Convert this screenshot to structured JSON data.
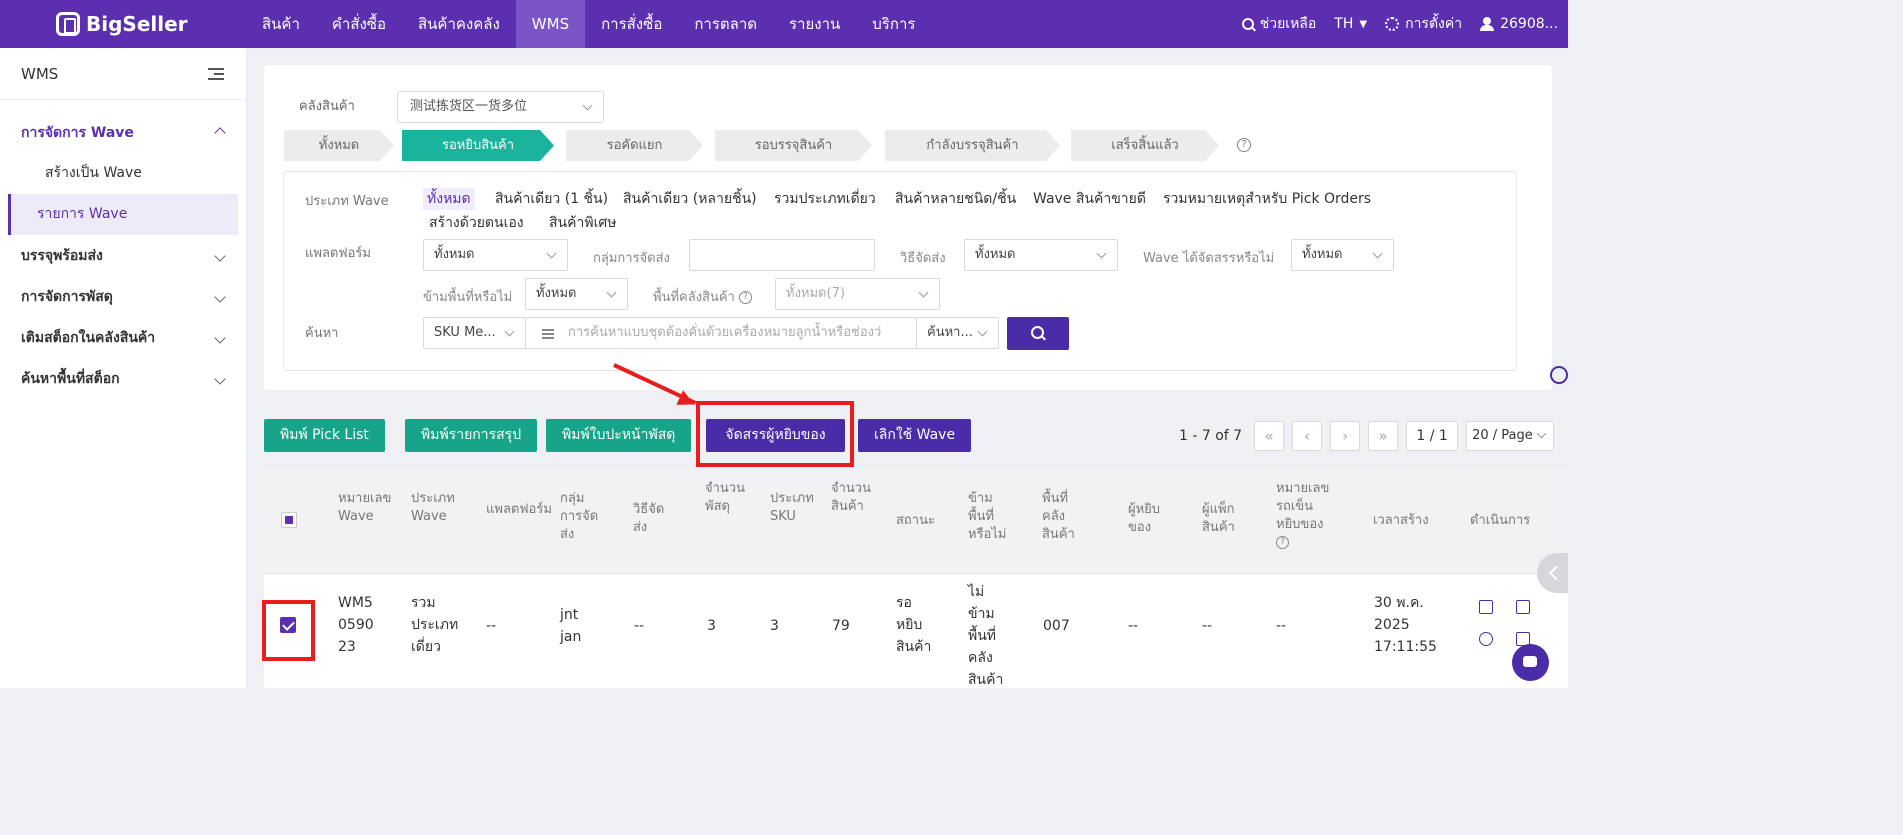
{
  "app": {
    "brand": "BigSeller"
  },
  "nav": {
    "items": [
      "สินค้า",
      "คำสั่งซื้อ",
      "สินค้าคงคลัง",
      "WMS",
      "การสั่งซื้อ",
      "การตลาด",
      "รายงาน",
      "บริการ"
    ],
    "active": "WMS",
    "help": "ช่วยเหลือ",
    "lang": "TH",
    "settings": "การตั้งค่า",
    "user": "26908..."
  },
  "sidebar": {
    "title": "WMS",
    "groups": [
      {
        "label": "การจัดการ Wave",
        "open": true,
        "children": [
          "สร้างเป็น Wave",
          "รายการ Wave"
        ]
      },
      {
        "label": "บรรจุพร้อมส่ง"
      },
      {
        "label": "การจัดการพัสดุ"
      },
      {
        "label": "เติมสต็อกในคลังสินค้า"
      },
      {
        "label": "ค้นหาพื้นที่สต็อก"
      }
    ],
    "active_child": "รายการ Wave"
  },
  "filter": {
    "warehouse_label": "คลังสินค้า",
    "warehouse_value": "测试拣货区一货多位",
    "steps": [
      "ทั้งหมด",
      "รอหยิบสินค้า",
      "รอคัดแยก",
      "รอบรรจุสินค้า",
      "กำลังบรรจุสินค้า",
      "เสร็จสิ้นแล้ว"
    ],
    "active_step": "รอหยิบสินค้า",
    "help_mark": "?",
    "wave_type_label": "ประเภท Wave",
    "wave_types": [
      "ทั้งหมด",
      "สินค้าเดียว (1 ชิ้น)",
      "สินค้าเดียว (หลายชิ้น)",
      "รวมประเภทเดี่ยว",
      "สินค้าหลายชนิด/ชิ้น",
      "Wave สินค้าขายดี",
      "รวมหมายเหตุสำหรับ Pick Orders",
      "สร้างด้วยตนเอง",
      "สินค้าพิเศษ"
    ],
    "platform_label": "แพลตฟอร์ม",
    "platform_value": "ทั้งหมด",
    "ship_group_label": "กลุ่มการจัดส่ง",
    "ship_group_value": "",
    "ship_method_label": "วิธีจัดส่ง",
    "ship_method_value": "ทั้งหมด",
    "assigned_label": "Wave ได้จัดสรรหรือไม่",
    "assigned_value": "ทั้งหมด",
    "cross_area_label": "ข้ามพื้นที่หรือไม่",
    "cross_area_value": "ทั้งหมด",
    "area_label": "พื้นที่คลังสินค้า",
    "area_value": "ทั้งหมด(7)",
    "search_label": "ค้นหา",
    "search_field": "SKU Me...",
    "search_placeholder": "การค้นหาแบบชุดต้องคั่นด้วยเครื่องหมายลูกน้ำหรือช่องว่",
    "search_mode": "ค้นหา..."
  },
  "actions": {
    "print_pick_list": "พิมพ์ Pick List",
    "print_summary": "พิมพ์รายการสรุป",
    "print_label": "พิมพ์ใบปะหน้าพัสดุ",
    "assign_picker": "จัดสรรผู้หยิบของ",
    "cancel_wave": "เลิกใช้ Wave"
  },
  "pager": {
    "range": "1 - 7 of 7",
    "page": "1 / 1",
    "size": "20 / Page"
  },
  "table": {
    "headers": [
      "หมายเลข Wave",
      "ประเภท Wave",
      "แพลตฟอร์ม",
      "กลุ่มการจัดส่ง",
      "วิธีจัดส่ง",
      "จำนวนพัสดุ",
      "ประเภท SKU",
      "จำนวนสินค้า",
      "สถานะ",
      "ข้ามพื้นที่หรือไม่",
      "พื้นที่คลังสินค้า",
      "ผู้หยิบของ",
      "ผู้แพ็กสินค้า",
      "หมายเลขรถเข็นหยิบของ",
      "เวลาสร้าง",
      "ดำเนินการ"
    ],
    "rows": [
      [
        "WM5059023",
        "รวมประเภทเดี่ยว",
        "--",
        "jnt jan",
        "--",
        "3",
        "3",
        "79",
        "รอหยิบสินค้า",
        "ไม่ข้ามพื้นที่คลังสินค้า",
        "007",
        "--",
        "--",
        "--",
        "30 พ.ค. 2025 17:11:55"
      ]
    ]
  },
  "colors": {
    "brand": "#5b2fb0",
    "accent_green": "#17a589",
    "highlight": "#e81d1d"
  }
}
